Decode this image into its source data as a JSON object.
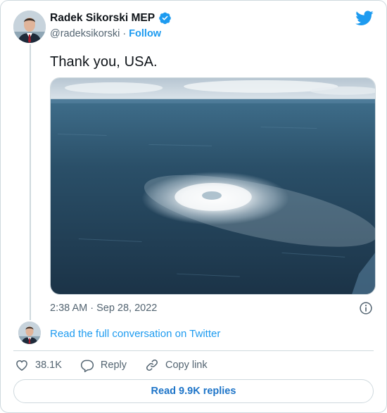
{
  "author": {
    "name": "Radek Sikorski MEP",
    "handle": "@radeksikorski",
    "separator": "·",
    "follow_label": "Follow",
    "verified": true
  },
  "tweet": {
    "text": "Thank you, USA.",
    "timestamp": "2:38 AM · Sep 28, 2022"
  },
  "conversation_link": "Read the full conversation on Twitter",
  "actions": {
    "likes": "38.1K",
    "reply_label": "Reply",
    "copy_label": "Copy link"
  },
  "replies_button": "Read 9.9K replies",
  "colors": {
    "accent": "#1d9bf0",
    "text": "#0f1419",
    "muted": "#536471",
    "border": "#cfd9de"
  },
  "icons": [
    "verified-badge-icon",
    "twitter-bird-icon",
    "info-icon",
    "heart-icon",
    "reply-bubble-icon",
    "link-icon"
  ]
}
